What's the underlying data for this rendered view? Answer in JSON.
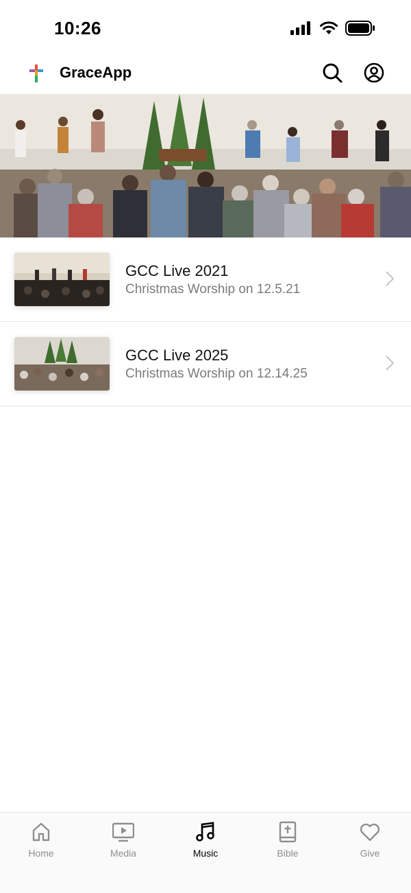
{
  "status_bar": {
    "time": "10:26"
  },
  "header": {
    "app_name": "GraceApp"
  },
  "list": [
    {
      "title": "GCC Live 2021",
      "subtitle": "Christmas Worship on 12.5.21"
    },
    {
      "title": "GCC Live 2025",
      "subtitle": "Christmas Worship on 12.14.25"
    }
  ],
  "tabs": [
    {
      "label": "Home",
      "icon": "home-icon",
      "active": false
    },
    {
      "label": "Media",
      "icon": "media-icon",
      "active": false
    },
    {
      "label": "Music",
      "icon": "music-icon",
      "active": true
    },
    {
      "label": "Bible",
      "icon": "bible-icon",
      "active": false
    },
    {
      "label": "Give",
      "icon": "heart-icon",
      "active": false
    }
  ],
  "colors": {
    "active_tab": "#000000",
    "inactive_tab": "#8e8e8e",
    "subtitle": "#7a7a7a"
  }
}
